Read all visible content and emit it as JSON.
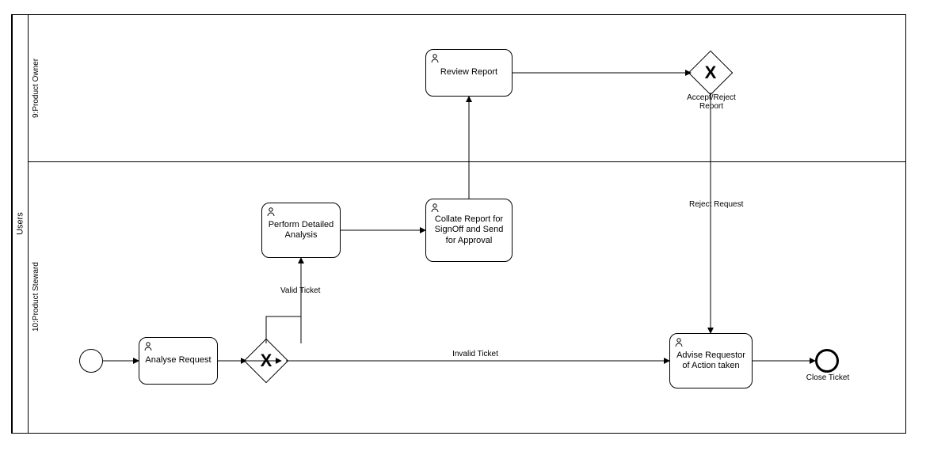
{
  "pool": {
    "label": "Users"
  },
  "lanes": {
    "top": {
      "label": "9:Product Owner"
    },
    "bottom": {
      "label": "10:Product Steward"
    }
  },
  "tasks": {
    "analyse": {
      "label": "Analyse Request"
    },
    "perform": {
      "label": "Perform Detailed Analysis"
    },
    "collate": {
      "label": "Collate Report for SignOff and Send for Approval"
    },
    "review": {
      "label": "Review Report"
    },
    "advise": {
      "label": "Advise Requestor of Action taken"
    }
  },
  "gateways": {
    "g1": {
      "marker": "X"
    },
    "g2": {
      "marker": "X",
      "label": "Accept/Reject Report"
    }
  },
  "events": {
    "end": {
      "label": "Close Ticket"
    }
  },
  "flows": {
    "validTicket": {
      "label": "Valid Ticket"
    },
    "invalidTicket": {
      "label": "Invalid Ticket"
    },
    "rejectRequest": {
      "label": "Reject Request"
    }
  },
  "chart_data": {
    "type": "bpmn",
    "pool": "Users",
    "lanes": [
      "9:Product Owner",
      "10:Product Steward"
    ],
    "nodes": [
      {
        "id": "start",
        "type": "startEvent",
        "lane": "10:Product Steward"
      },
      {
        "id": "analyse",
        "type": "userTask",
        "label": "Analyse Request",
        "lane": "10:Product Steward"
      },
      {
        "id": "g1",
        "type": "exclusiveGateway",
        "lane": "10:Product Steward"
      },
      {
        "id": "perform",
        "type": "userTask",
        "label": "Perform Detailed Analysis",
        "lane": "10:Product Steward"
      },
      {
        "id": "collate",
        "type": "userTask",
        "label": "Collate Report for SignOff and Send for Approval",
        "lane": "10:Product Steward"
      },
      {
        "id": "review",
        "type": "userTask",
        "label": "Review Report",
        "lane": "9:Product Owner"
      },
      {
        "id": "g2",
        "type": "exclusiveGateway",
        "label": "Accept/Reject Report",
        "lane": "9:Product Owner"
      },
      {
        "id": "advise",
        "type": "userTask",
        "label": "Advise Requestor of Action taken",
        "lane": "10:Product Steward"
      },
      {
        "id": "end",
        "type": "endEvent",
        "label": "Close Ticket",
        "lane": "10:Product Steward"
      }
    ],
    "edges": [
      {
        "from": "start",
        "to": "analyse"
      },
      {
        "from": "analyse",
        "to": "g1"
      },
      {
        "from": "g1",
        "to": "perform",
        "label": "Valid Ticket"
      },
      {
        "from": "g1",
        "to": "advise",
        "label": "Invalid Ticket"
      },
      {
        "from": "perform",
        "to": "collate"
      },
      {
        "from": "collate",
        "to": "review"
      },
      {
        "from": "review",
        "to": "g2"
      },
      {
        "from": "g2",
        "to": "advise",
        "label": "Reject Request"
      },
      {
        "from": "advise",
        "to": "end"
      }
    ]
  }
}
